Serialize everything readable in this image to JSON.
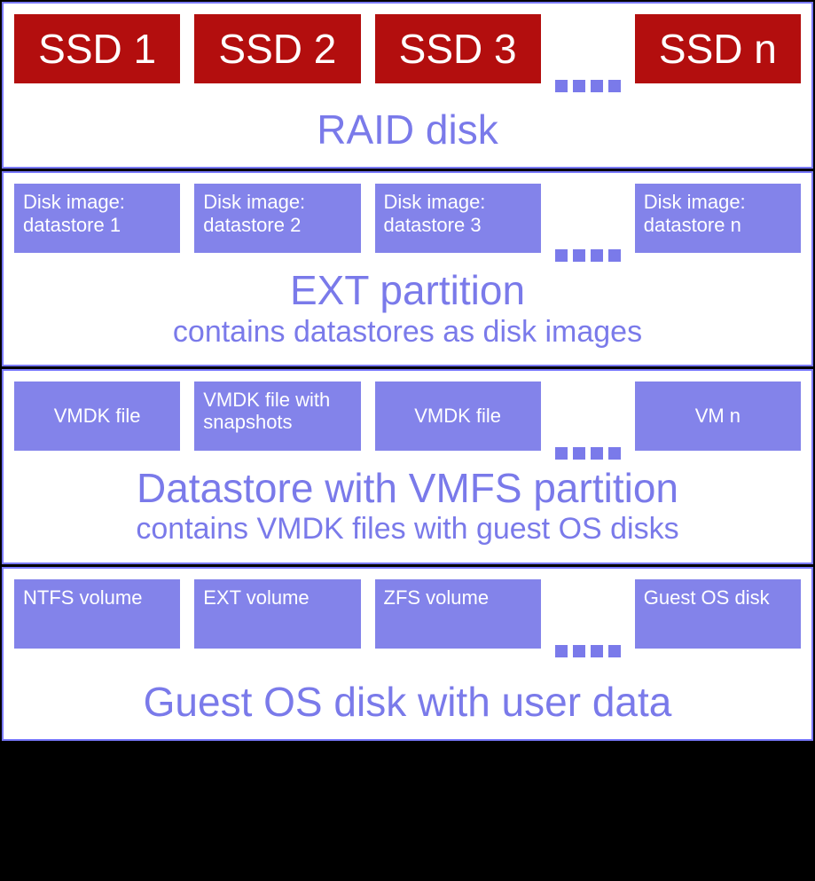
{
  "layers": [
    {
      "title": "RAID disk",
      "subtitle": "",
      "style": "ssd",
      "items": [
        "SSD 1",
        "SSD 2",
        "SSD 3",
        "SSD n"
      ]
    },
    {
      "title": "EXT partition",
      "subtitle": "contains datastores as disk images",
      "style": "purple",
      "items": [
        "Disk image: datastore 1",
        "Disk image: datastore 2",
        "Disk image: datastore 3",
        "Disk image: datastore n"
      ]
    },
    {
      "title": "Datastore with VMFS partition",
      "subtitle": "contains VMDK files with guest OS disks",
      "style": "purple",
      "items": [
        "VMDK file",
        "VMDK file with snapshots",
        "VMDK file",
        "VM n"
      ]
    },
    {
      "title": "Guest OS disk with user data",
      "subtitle": "",
      "style": "purple",
      "items": [
        "NTFS volume",
        "EXT volume",
        "ZFS volume",
        "Guest OS disk"
      ]
    }
  ]
}
